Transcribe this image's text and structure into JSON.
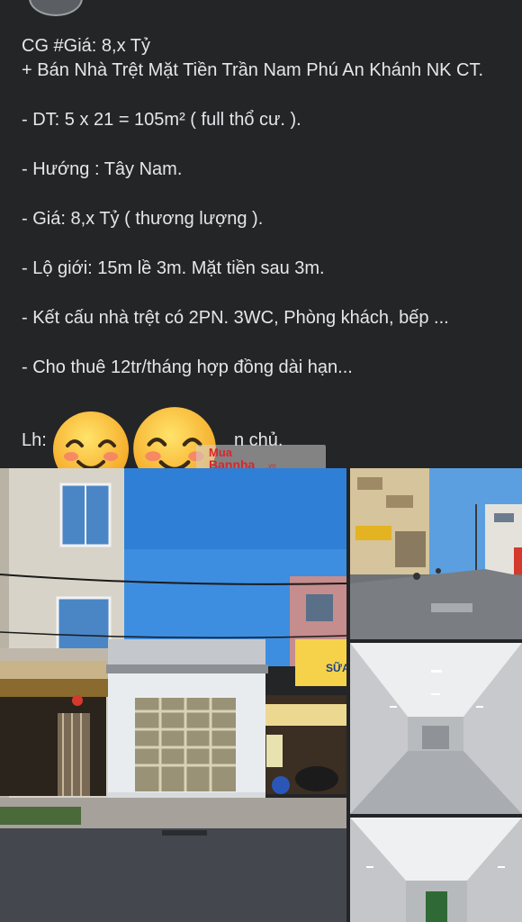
{
  "post": {
    "title_line": "CG #Giá: 8,x Tỷ",
    "subtitle_line": "+ Bán Nhà Trệt Mặt Tiền Trần Nam Phú An Khánh NK CT.",
    "items": [
      "- DT: 5 x 21 = 105m² ( full thổ cư. ).",
      "- Hướng : Tây Nam.",
      "- Giá: 8,x Tỷ ( thương lượng ).",
      "- Lộ giới: 15m lề 3m. Mặt tiền sau 3m.",
      "- Kết cấu nhà trệt có 2PN. 3WC, Phòng khách, bếp ...",
      "- Cho thuê 12tr/tháng hợp đồng dài hạn..."
    ],
    "contact_label": "Lh:",
    "contact_suffix": "n chủ."
  },
  "watermark": {
    "line1": "Mua",
    "line2": "Bannha",
    "line3": ".vn"
  },
  "photos": {
    "main_sign": "SỮA"
  },
  "icons": {
    "emoji_1": "smiling-face-icon",
    "emoji_2": "smiling-face-icon"
  },
  "colors": {
    "background": "#242526",
    "text": "#e4e6eb",
    "watermark_red": "#d9262c"
  }
}
